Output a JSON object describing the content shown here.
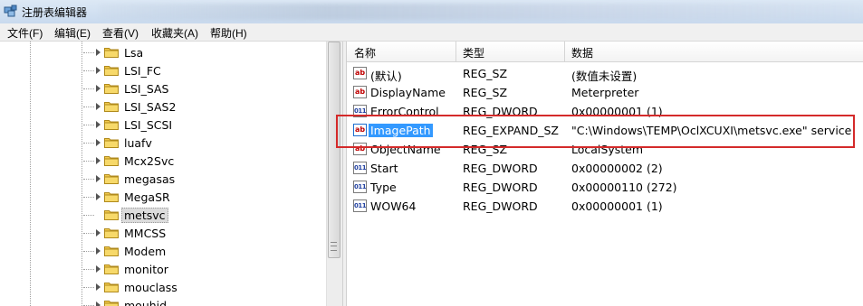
{
  "window": {
    "title": "注册表编辑器",
    "app_icon": "regedit-icon"
  },
  "menu": [
    {
      "label": "文件(F)"
    },
    {
      "label": "编辑(E)"
    },
    {
      "label": "查看(V)"
    },
    {
      "label": "收藏夹(A)"
    },
    {
      "label": "帮助(H)"
    }
  ],
  "tree": {
    "items": [
      {
        "label": "Lsa"
      },
      {
        "label": "LSI_FC"
      },
      {
        "label": "LSI_SAS"
      },
      {
        "label": "LSI_SAS2"
      },
      {
        "label": "LSI_SCSI"
      },
      {
        "label": "luafv"
      },
      {
        "label": "Mcx2Svc"
      },
      {
        "label": "megasas"
      },
      {
        "label": "MegaSR"
      },
      {
        "label": "metsvc",
        "selected": true
      },
      {
        "label": "MMCSS"
      },
      {
        "label": "Modem"
      },
      {
        "label": "monitor"
      },
      {
        "label": "mouclass"
      },
      {
        "label": "mouhid"
      }
    ]
  },
  "list": {
    "headers": {
      "name": "名称",
      "type": "类型",
      "data": "数据"
    },
    "rows": [
      {
        "icon": "ab",
        "name": "(默认)",
        "type": "REG_SZ",
        "data": "(数值未设置)"
      },
      {
        "icon": "ab",
        "name": "DisplayName",
        "type": "REG_SZ",
        "data": "Meterpreter"
      },
      {
        "icon": "dw",
        "name": "ErrorControl",
        "type": "REG_DWORD",
        "data": "0x00000001 (1)"
      },
      {
        "icon": "ab",
        "name": "ImagePath",
        "type": "REG_EXPAND_SZ",
        "data": "\"C:\\Windows\\TEMP\\OclXCUXI\\metsvc.exe\" service",
        "selected": true
      },
      {
        "icon": "ab",
        "name": "ObjectName",
        "type": "REG_SZ",
        "data": "LocalSystem"
      },
      {
        "icon": "dw",
        "name": "Start",
        "type": "REG_DWORD",
        "data": "0x00000002 (2)"
      },
      {
        "icon": "dw",
        "name": "Type",
        "type": "REG_DWORD",
        "data": "0x00000110 (272)"
      },
      {
        "icon": "dw",
        "name": "WOW64",
        "type": "REG_DWORD",
        "data": "0x00000001 (1)"
      }
    ]
  },
  "colors": {
    "highlight_box": "#d42a2a",
    "selection": "#3399ff"
  }
}
